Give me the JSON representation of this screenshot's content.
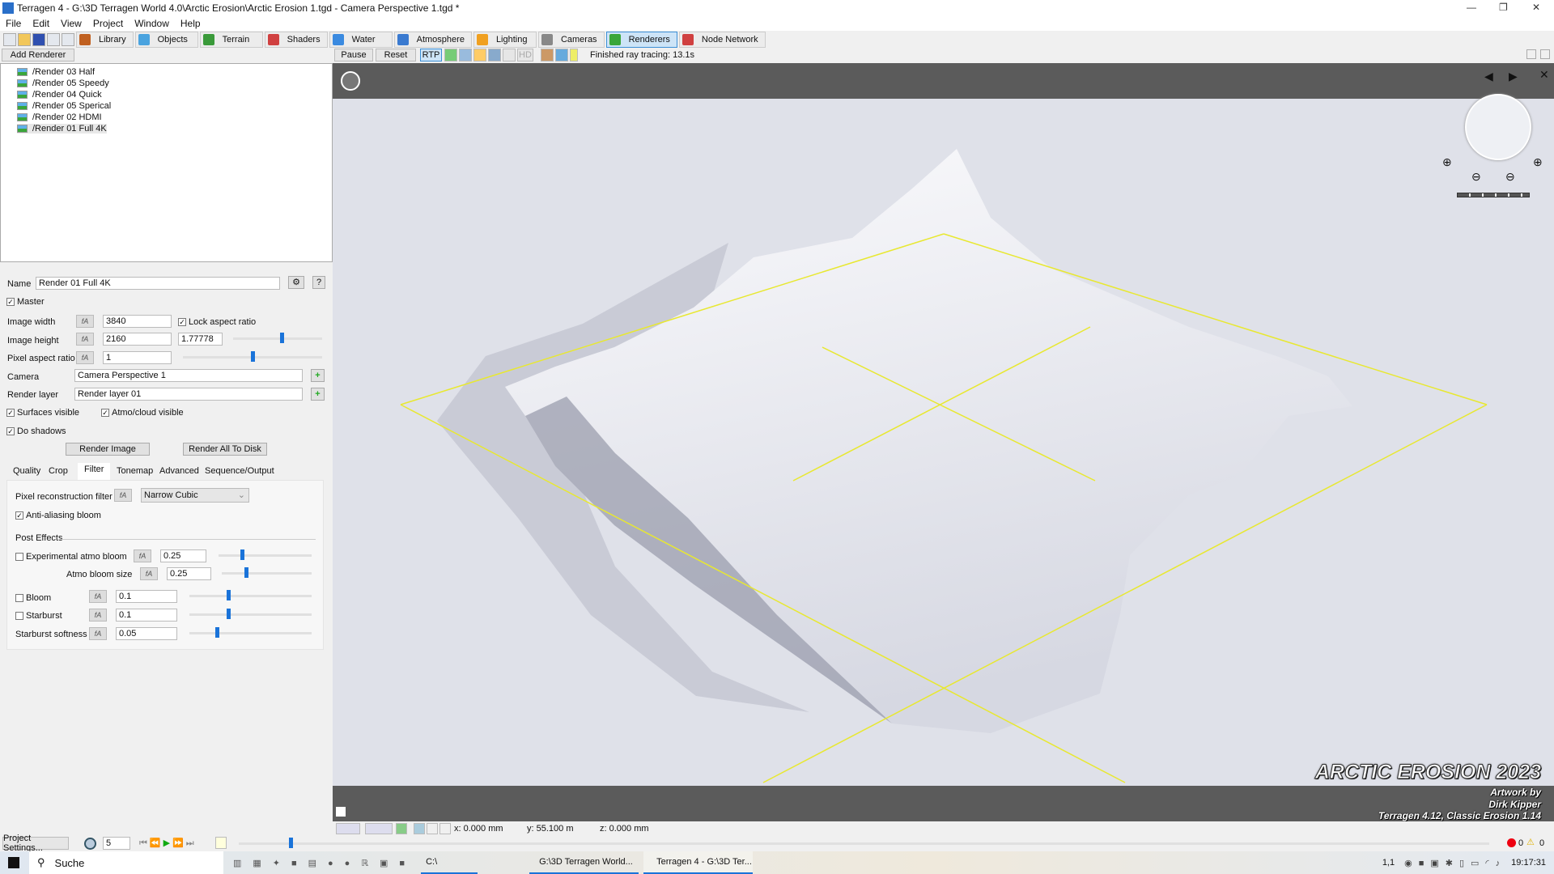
{
  "window": {
    "title": "Terragen 4 - G:\\3D Terragen World 4.0\\Arctic Erosion\\Arctic Erosion 1.tgd - Camera Perspective 1.tgd *"
  },
  "menu": [
    "File",
    "Edit",
    "View",
    "Project",
    "Window",
    "Help"
  ],
  "toolbar": {
    "buttons": [
      {
        "label": "Library",
        "icon": "books-icon",
        "color": "#c06020"
      },
      {
        "label": "Objects",
        "icon": "cube-icon",
        "color": "#4aa3df"
      },
      {
        "label": "Terrain",
        "icon": "terrain-icon",
        "color": "#3a9a3a"
      },
      {
        "label": "Shaders",
        "icon": "sphere-icon",
        "color": "#d04040"
      },
      {
        "label": "Water",
        "icon": "drop-icon",
        "color": "#3a8ae0"
      },
      {
        "label": "Atmosphere",
        "icon": "sky-icon",
        "color": "#3a7ad0"
      },
      {
        "label": "Lighting",
        "icon": "sun-icon",
        "color": "#f0a020"
      },
      {
        "label": "Cameras",
        "icon": "camera-icon",
        "color": "#888888"
      },
      {
        "label": "Renderers",
        "icon": "render-icon",
        "color": "#3aa63a",
        "active": true
      },
      {
        "label": "Node Network",
        "icon": "node-network-icon",
        "color": "#d04040"
      }
    ]
  },
  "toolbar2": {
    "add_renderer": "Add Renderer",
    "pause": "Pause",
    "reset": "Reset",
    "rtp": "RTP",
    "hd": "HD",
    "status": "Finished ray tracing: 13.1s"
  },
  "renderers": [
    "/Render 03 Half",
    "/Render 05 Speedy",
    "/Render 04 Quick",
    "/Render 05 Sperical",
    "/Render 02 HDMI",
    "/Render 01 Full 4K"
  ],
  "props": {
    "name_label": "Name",
    "name": "Render 01 Full 4K",
    "help": "?",
    "master": "Master",
    "width_label": "Image width",
    "width": "3840",
    "lock_aspect": "Lock aspect ratio",
    "height_label": "Image height",
    "height": "2160",
    "aspect": "1.77778",
    "aspect_slider": 0.55,
    "par_label": "Pixel aspect ratio",
    "par": "1",
    "par_slider": 0.5,
    "camera_label": "Camera",
    "camera": "Camera Perspective 1",
    "layer_label": "Render layer",
    "layer": "Render layer 01",
    "surfaces": "Surfaces visible",
    "atmo": "Atmo/cloud visible",
    "shadows": "Do shadows",
    "render_image": "Render Image",
    "render_all": "Render All To Disk",
    "fx": "fA"
  },
  "tabs": [
    "Quality",
    "Crop",
    "Filter",
    "Tonemap",
    "Advanced",
    "Sequence/Output"
  ],
  "active_tab": "Filter",
  "filter": {
    "pixel_filter_label": "Pixel reconstruction filter",
    "pixel_filter": "Narrow Cubic",
    "aa_bloom": "Anti-aliasing bloom",
    "post_effects": "Post Effects",
    "exp_bloom": "Experimental atmo bloom",
    "exp_bloom_val": "0.25",
    "bloom_size": "Atmo bloom size",
    "bloom_size_val": "0.25",
    "bloom": "Bloom",
    "bloom_val": "0.1",
    "starburst": "Starburst",
    "starburst_val": "0.1",
    "softness": "Starburst softness",
    "softness_val": "0.05"
  },
  "viewport": {
    "art_title": "ARCTIC EROSION 2023",
    "art_line1": "Artwork by",
    "art_line2": "Dirk Kipper",
    "art_line3": "Terragen 4.12, Classic Erosion 1.14",
    "frame_color": "#e8e830"
  },
  "status": {
    "x": "x: 0.000 mm",
    "y": "y: 55.100 m",
    "z": "z: 0.000 mm"
  },
  "timeline": {
    "project_settings": "Project Settings...",
    "frame": "5",
    "errors": "0",
    "warnings": "0"
  },
  "taskbar": {
    "search": "Suche",
    "c_drive": "C:\\",
    "explorer": "G:\\3D Terragen World...",
    "terragen": "Terragen 4 - G:\\3D Ter...",
    "tray_num": "1,1",
    "clock": "19:17:31"
  }
}
